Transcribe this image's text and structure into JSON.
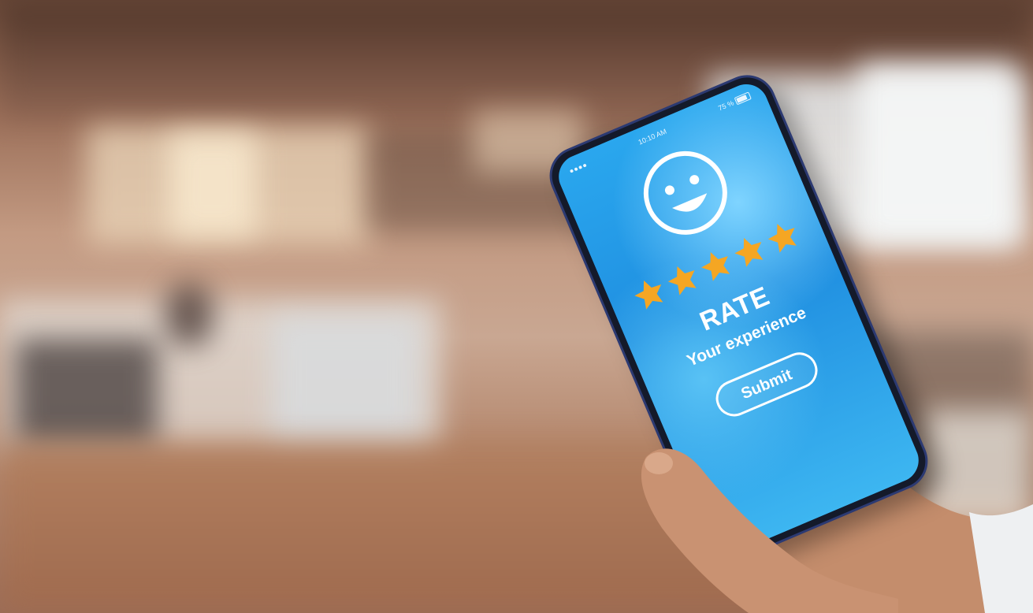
{
  "status_bar": {
    "time": "10:10 AM",
    "battery": "75 %"
  },
  "screen": {
    "icon": "smiley-face-icon",
    "rating": {
      "value": 5,
      "max": 5,
      "star_color": "#f5a623"
    },
    "title": "RATE",
    "subtitle": "Your experience",
    "submit_label": "Submit",
    "accent_color": "#2aa7ee"
  }
}
